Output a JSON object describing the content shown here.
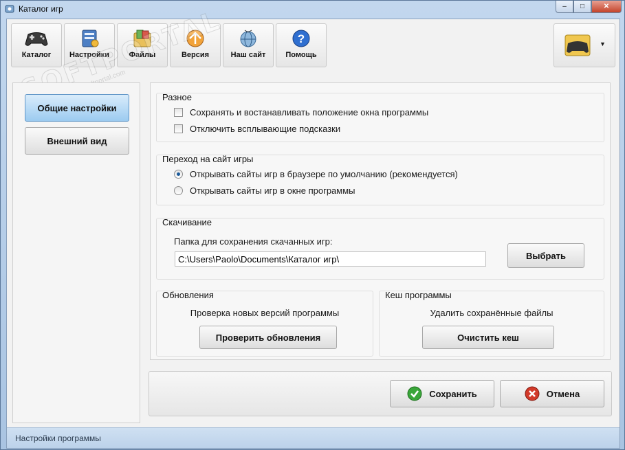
{
  "window": {
    "title": "Каталог игр",
    "controls": {
      "minimize": "–",
      "maximize": "□",
      "close": "✕"
    }
  },
  "toolbar": {
    "items": [
      {
        "label": "Каталог",
        "icon": "gamepad-icon"
      },
      {
        "label": "Настройки",
        "icon": "settings-icon"
      },
      {
        "label": "Файлы",
        "icon": "files-icon"
      },
      {
        "label": "Версия",
        "icon": "version-icon"
      },
      {
        "label": "Наш сайт",
        "icon": "globe-icon"
      },
      {
        "label": "Помощь",
        "icon": "help-icon"
      }
    ],
    "profile": {
      "icon": "user-folder-icon",
      "dropdown": "▼"
    }
  },
  "watermark": {
    "big": "SOFTPORTAL",
    "small": "www.softportal.com",
    "tm": "TM"
  },
  "sidebar": {
    "items": [
      {
        "label": "Общие настройки",
        "active": true
      },
      {
        "label": "Внешний вид",
        "active": false
      }
    ]
  },
  "misc": {
    "title": "Разное",
    "options": [
      "Сохранять и востанавливать положение окна программы",
      "Отключить всплывающие подсказки"
    ]
  },
  "site": {
    "title": "Переход на сайт игры",
    "options": [
      "Открывать сайты игр в браузере по умолчанию (рекомендуется)",
      "Открывать сайты игр в окне программы"
    ]
  },
  "download": {
    "title": "Скачивание",
    "label": "Папка для сохранения скачанных игр:",
    "path": "C:\\Users\\Paolo\\Documents\\Каталог игр\\",
    "choose_button": "Выбрать"
  },
  "updates": {
    "title": "Обновления",
    "text": "Проверка новых версий программы",
    "button": "Проверить обновления"
  },
  "cache": {
    "title": "Кеш программы",
    "text": "Удалить сохранённые файлы",
    "button": "Очистить кеш"
  },
  "footer": {
    "save": "Сохранить",
    "cancel": "Отмена"
  },
  "status": {
    "text": "Настройки программы"
  },
  "colors": {
    "active_tab": "#9ccbf0",
    "ok_green": "#3aa63a",
    "cancel_red": "#d23a2a",
    "radio_dot": "#1b5a9a"
  }
}
